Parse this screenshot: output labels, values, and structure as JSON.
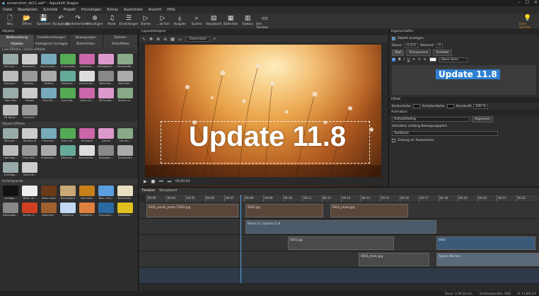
{
  "window": {
    "title": "screenshot_de11.adr* - AquaSoft Stages"
  },
  "menu": [
    "Datei",
    "Bearbeiten",
    "Schnitte",
    "Projekt",
    "Hinzufügen",
    "Extras",
    "Ausrichten",
    "Ansicht",
    "Hilfe"
  ],
  "toolbar": [
    {
      "icon": "🗋",
      "label": "Neu"
    },
    {
      "icon": "📂",
      "label": "Öffnen"
    },
    {
      "icon": "💾",
      "label": "Speichern"
    },
    {
      "icon": "↶",
      "label": "Rückgängig"
    },
    {
      "icon": "↷",
      "label": "Wiederherstellen"
    },
    {
      "icon": "⊕",
      "label": "Hinzufügen"
    },
    {
      "icon": "♫",
      "label": "Musik"
    },
    {
      "icon": "☰",
      "label": "Einstellungen"
    },
    {
      "icon": "▷",
      "label": "Starten"
    },
    {
      "icon": "▷",
      "label": "... ab hier"
    },
    {
      "icon": "⤓",
      "label": "Ausgabe"
    },
    {
      "icon": "⌕",
      "label": "Suchen"
    },
    {
      "icon": "▤",
      "label": "Storyboard"
    },
    {
      "icon": "▦",
      "label": "Bilderliste"
    },
    {
      "icon": "▥",
      "label": "Toolbox"
    },
    {
      "icon": "▭",
      "label": "Vert. Timeline"
    },
    {
      "icon": "💡",
      "label": "Erste Schritte"
    }
  ],
  "left": {
    "header": "Objekte",
    "tabs1": [
      "Bildbereitung",
      "Audiobereitungen",
      "Bewegungen",
      "Dateien"
    ],
    "tabs2": [
      "Objekte",
      "Intelligente Vorlagen",
      "Bilderfelder",
      "Texteffekte"
    ],
    "section1": "Live-Effekte / Video-Effekte",
    "effects": [
      "Bild von...",
      "Bildbereit...",
      "Blumenwie...",
      "Chromakey",
      "Farbverla...",
      "Farbabgleic...",
      "Fenstereffe...",
      "Displace...",
      "Masken...",
      "Halbton",
      "Halbtono...",
      "Elementef...",
      "Weichzei...",
      "Weichzei...",
      "Alter Film",
      "Mosaik",
      "Foto-Ma...",
      "Form-Ma...",
      "Glanz-Sc...",
      "3D-Schatt...",
      "Verzerrun...",
      "3D-Rotat...",
      "Tonwertl..."
    ],
    "section2": "Objekt-Effekte",
    "objects": [
      "Bild-von...",
      "Bildbaund",
      "Flimmstr...",
      "Foto-Coll...",
      "Animator",
      "Galerie",
      "Fotr-Bo...",
      "Überlapp...",
      "Plast.Effe...",
      "Zufallsvan...",
      "Wischkle...",
      "Kamerafah...",
      "Bewegun...",
      "Einblenden",
      "Zufällige...",
      "Verschle..."
    ],
    "section3": "Hintergründe",
    "backgrounds": [
      "Farbiger...",
      "Weiß. Ha...",
      "Altes Leder",
      "Backpapier",
      "Bernstein",
      "Blau, sich...",
      "Blumenwi...",
      "Betonwän...",
      "Bunter S...",
      "Kalemod...",
      "Eifelturm",
      "Farbtönle...",
      "Farbverla...",
      "Farbverla..."
    ]
  },
  "center": {
    "header": "Layoutdesigner",
    "zoom": "Zoomstufe",
    "overlay_text": "Update 11.8",
    "time": "00:00:00"
  },
  "right": {
    "header": "Eigenschaften",
    "show_object": "Objekt anzeigen",
    "dauer_label": "Dauer:",
    "dauer_value": "0,472",
    "abstand_label": "Abstand:",
    "abstand_value": "0",
    "tabs": [
      "Text",
      "Transparenz",
      "Einfader"
    ],
    "font": "Open Sans",
    "preview_text": "Update 11.8",
    "effekt_header": "Effekt",
    "kontur_label": "Konturfarbe",
    "schatten_label": "Schattenfarbe",
    "deckkraft_label": "Deckkraft",
    "deckkraft_value": "100 %",
    "animation_header": "Animation",
    "animation_value": "Aufsatzfading",
    "anpassen": "Anpassen",
    "verhalten": "Verhalten entlang Bewegungspfad",
    "textblock": "Textblock",
    "zeilung": "Zeilung im Textzeichen",
    "accent_color": "#2f7fd0"
  },
  "timeline": {
    "tabs": [
      "Timeline",
      "Storyboard"
    ],
    "ruler": [
      "00:00",
      "00:04",
      "00:05",
      "00:06",
      "00:07",
      "00:08",
      "00:09",
      "00:10",
      "00:11",
      "00:12",
      "00:13",
      "00:14",
      "00:15",
      "00:16",
      "00:17",
      "00:18",
      "00:19",
      "00:20",
      "00:21",
      "00:22"
    ],
    "clips": [
      {
        "label": "0001_ponds_photo.75005.jpg",
        "track": 0
      },
      {
        "label": "0002.jpg",
        "track": 0
      },
      {
        "label": "0003_photo.jpg",
        "track": 0
      },
      {
        "label": "Ebene 11, Update 11.8",
        "track": 1
      },
      {
        "label": "0004.jpg",
        "track": 2
      },
      {
        "label": "Weiß",
        "track": 2
      },
      {
        "label": "Tulpen, Blumen",
        "track": 3
      },
      {
        "label": "0005_photo.jpg",
        "track": 3
      }
    ]
  },
  "status": {
    "dauer": "Dauer: 1:09:30 min",
    "pos": "Schlüsselpunkte: 18/8",
    "coords": "D: 11,8/0,1/0"
  }
}
